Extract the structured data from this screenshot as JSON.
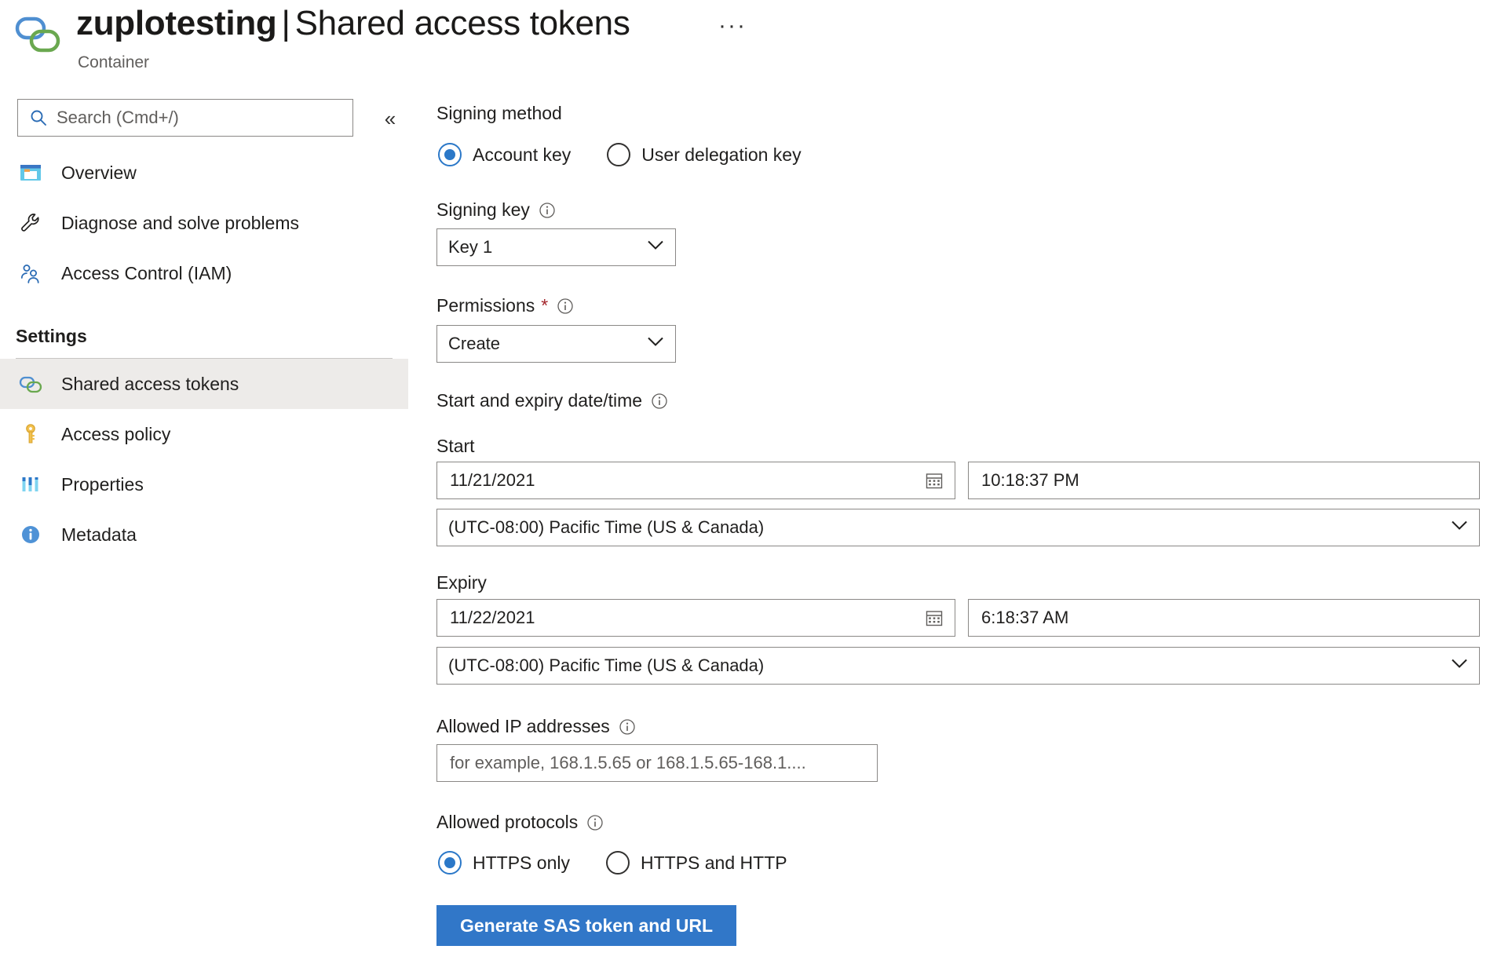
{
  "header": {
    "resource_name": "zuplotesting",
    "separator": "|",
    "blade_title": "Shared access tokens",
    "resource_kind": "Container",
    "more_menu": "···"
  },
  "sidebar": {
    "search": {
      "placeholder": "Search (Cmd+/)",
      "value": ""
    },
    "collapse_label": "«",
    "items": [
      {
        "label": "Overview",
        "icon": "overview-icon",
        "selected": false
      },
      {
        "label": "Diagnose and solve problems",
        "icon": "wrench-icon",
        "selected": false
      },
      {
        "label": "Access Control (IAM)",
        "icon": "people-icon",
        "selected": false
      }
    ],
    "section_title": "Settings",
    "settings_items": [
      {
        "label": "Shared access tokens",
        "icon": "link-rings-icon",
        "selected": true
      },
      {
        "label": "Access policy",
        "icon": "key-icon",
        "selected": false
      },
      {
        "label": "Properties",
        "icon": "properties-bars-icon",
        "selected": false
      },
      {
        "label": "Metadata",
        "icon": "info-circle-icon",
        "selected": false
      }
    ]
  },
  "form": {
    "signing_method": {
      "label": "Signing method",
      "options": [
        {
          "label": "Account key",
          "selected": true
        },
        {
          "label": "User delegation key",
          "selected": false
        }
      ]
    },
    "signing_key": {
      "label": "Signing key",
      "value": "Key 1",
      "info": "info-icon"
    },
    "permissions": {
      "label": "Permissions",
      "required_marker": "*",
      "value": "Create",
      "info": "info-icon"
    },
    "date_range": {
      "label": "Start and expiry date/time",
      "info": "info-icon",
      "start": {
        "label": "Start",
        "date": "11/21/2021",
        "time": "10:18:37 PM",
        "timezone": "(UTC-08:00) Pacific Time (US & Canada)"
      },
      "expiry": {
        "label": "Expiry",
        "date": "11/22/2021",
        "time": "6:18:37 AM",
        "timezone": "(UTC-08:00) Pacific Time (US & Canada)"
      }
    },
    "allowed_ip": {
      "label": "Allowed IP addresses",
      "info": "info-icon",
      "value": "",
      "placeholder": "for example, 168.1.5.65 or 168.1.5.65-168.1...."
    },
    "allowed_protocols": {
      "label": "Allowed protocols",
      "info": "info-icon",
      "options": [
        {
          "label": "HTTPS only",
          "selected": true
        },
        {
          "label": "HTTPS and HTTP",
          "selected": false
        }
      ]
    },
    "generate_button": "Generate SAS token and URL"
  },
  "colors": {
    "accent_blue": "#3177c8",
    "radio_blue": "#2b78c8",
    "required_red": "#a4262c",
    "selected_row_bg": "#edebe9",
    "border_gray": "#8a8886",
    "icon_blue": "#4f8fd1",
    "icon_green": "#6aa84f",
    "icon_yellow": "#f0c419"
  }
}
